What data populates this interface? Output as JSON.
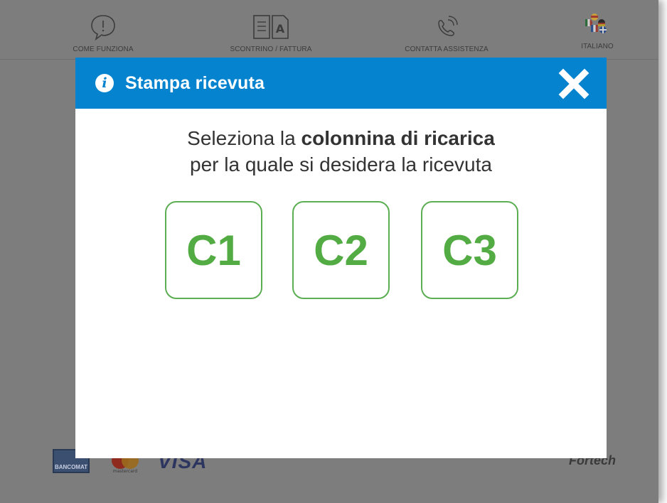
{
  "topnav": {
    "how_it_works": "COME FUNZIONA",
    "receipt_invoice": "SCONTRINO / FATTURA",
    "contact_support": "CONTATTA ASSISTENZA",
    "language": "ITALIANO"
  },
  "modal": {
    "title": "Stampa ricevuta",
    "prompt_line1_prefix": "Seleziona la ",
    "prompt_line1_bold": "colonnina di ricarica",
    "prompt_line2": "per la quale si desidera la ricevuta",
    "stations": [
      {
        "label": "C1"
      },
      {
        "label": "C2"
      },
      {
        "label": "C3"
      }
    ],
    "accent_color": "#0583cf",
    "station_color": "#52ac43"
  },
  "footer": {
    "pago_label": "BANCOMAT",
    "mastercard_label": "mastercard",
    "visa_label": "VISA",
    "fortech_label": "Fortech"
  }
}
